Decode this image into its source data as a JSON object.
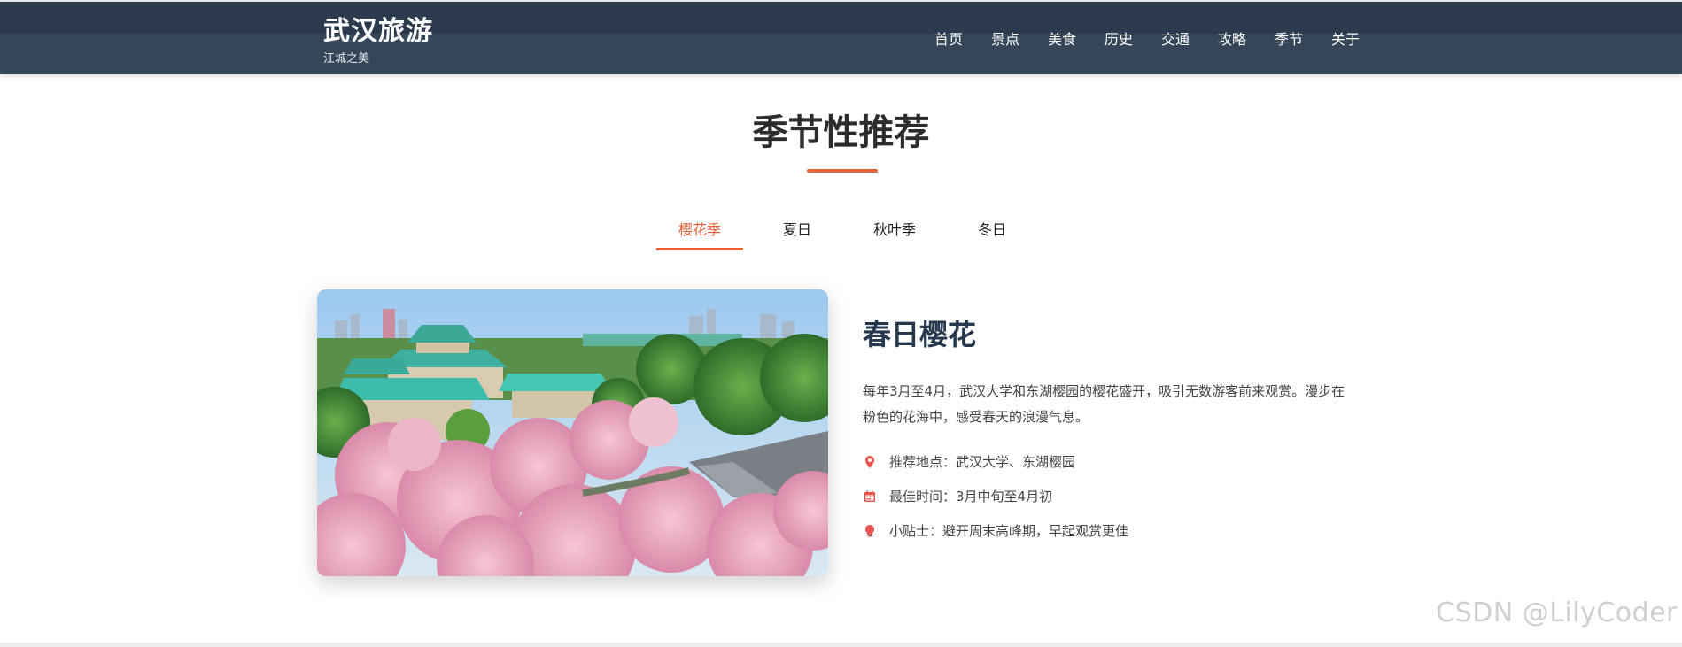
{
  "header": {
    "brand_title": "武汉旅游",
    "brand_subtitle": "江城之美",
    "nav": [
      "首页",
      "景点",
      "美食",
      "历史",
      "交通",
      "攻略",
      "季节",
      "关于"
    ]
  },
  "section": {
    "title": "季节性推荐"
  },
  "tabs": [
    {
      "label": "樱花季",
      "active": true
    },
    {
      "label": "夏日",
      "active": false
    },
    {
      "label": "秋叶季",
      "active": false
    },
    {
      "label": "冬日",
      "active": false
    }
  ],
  "season": {
    "title": "春日樱花",
    "description": "每年3月至4月，武汉大学和东湖樱园的樱花盛开，吸引无数游客前来观赏。漫步在粉色的花海中，感受春天的浪漫气息。",
    "info": [
      {
        "icon": "map-pin-icon",
        "text": "推荐地点：武汉大学、东湖樱园"
      },
      {
        "icon": "calendar-icon",
        "text": "最佳时间：3月中旬至4月初"
      },
      {
        "icon": "lightbulb-icon",
        "text": "小贴士：避开周末高峰期，早起观赏更佳"
      }
    ]
  },
  "watermark": "CSDN @LilyCoder",
  "colors": {
    "accent": "#e8623a",
    "header_bg": "#2b3a4d",
    "title_dark": "#26384d",
    "icon_red": "#e8554e"
  }
}
